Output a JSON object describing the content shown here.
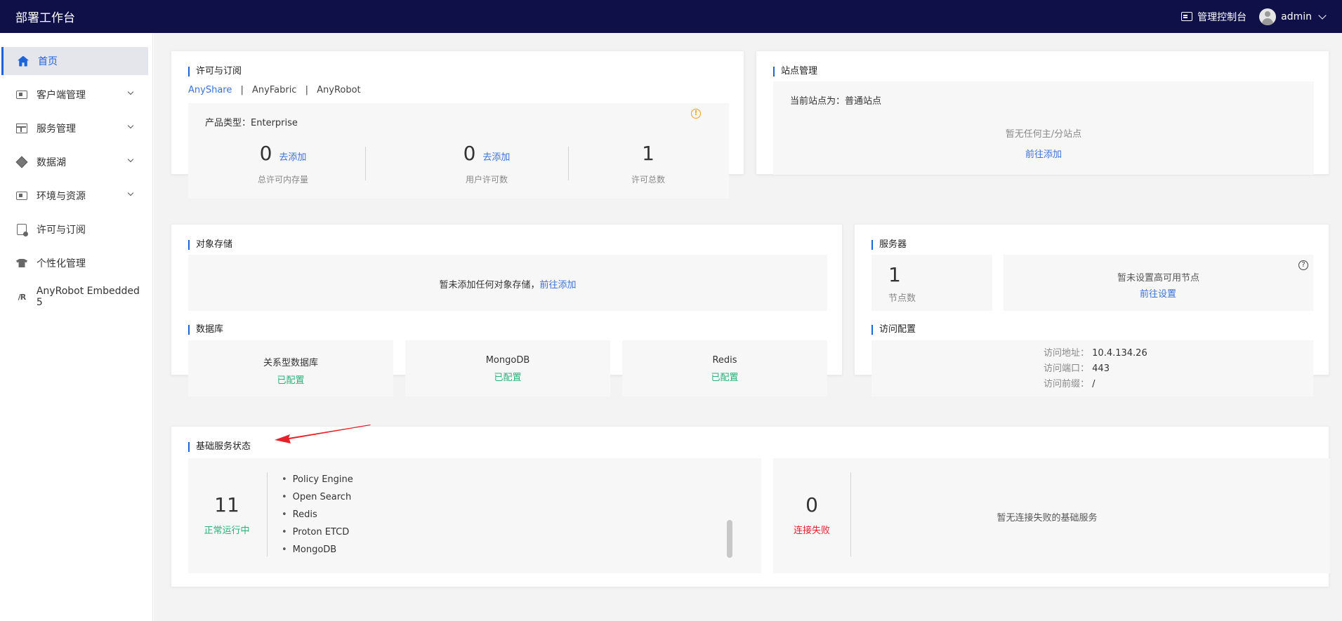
{
  "header": {
    "app_title": "部署工作台",
    "console_label": "管理控制台",
    "user_name": "admin"
  },
  "sidebar": {
    "items": [
      {
        "label": "首页",
        "icon": "home-icon",
        "active": true
      },
      {
        "label": "客户端管理",
        "icon": "client-icon",
        "expandable": true
      },
      {
        "label": "服务管理",
        "icon": "table-icon",
        "expandable": true
      },
      {
        "label": "数据湖",
        "icon": "diamond-icon",
        "expandable": true
      },
      {
        "label": "环境与资源",
        "icon": "code-icon",
        "expandable": true
      },
      {
        "label": "许可与订阅",
        "icon": "license-icon"
      },
      {
        "label": "个性化管理",
        "icon": "shirt-icon"
      },
      {
        "label": "AnyRobot Embedded 5",
        "icon": "anyrobot-icon"
      }
    ]
  },
  "license": {
    "title": "许可与订阅",
    "tabs": [
      "AnyShare",
      "AnyFabric",
      "AnyRobot"
    ],
    "separator": "|",
    "product_type_label": "产品类型：",
    "product_type_value": "Enterprise",
    "stats": [
      {
        "value": "0",
        "action": "去添加",
        "label": "总许可内存量"
      },
      {
        "value": "0",
        "action": "去添加",
        "label": "用户许可数"
      },
      {
        "value": "1",
        "action": "",
        "label": "许可总数"
      }
    ]
  },
  "site": {
    "title": "站点管理",
    "current_label": "当前站点为：",
    "current_value": "普通站点",
    "empty_text": "暂无任何主/分站点",
    "action": "前往添加"
  },
  "object_storage": {
    "title": "对象存储",
    "empty_text": "暂未添加任何对象存储，",
    "action": "前往添加"
  },
  "database": {
    "title": "数据库",
    "items": [
      {
        "name": "关系型数据库",
        "status": "已配置"
      },
      {
        "name": "MongoDB",
        "status": "已配置"
      },
      {
        "name": "Redis",
        "status": "已配置"
      }
    ]
  },
  "server": {
    "title": "服务器",
    "node_count": "1",
    "node_label": "节点数",
    "ha_text": "暂未设置高可用节点",
    "ha_action": "前往设置"
  },
  "access": {
    "title": "访问配置",
    "rows": [
      {
        "label": "访问地址：",
        "value": "10.4.134.26"
      },
      {
        "label": "访问端口：",
        "value": "443"
      },
      {
        "label": "访问前缀：",
        "value": "/"
      }
    ]
  },
  "base_services": {
    "title": "基础服务状态",
    "running_count": "11",
    "running_label": "正常运行中",
    "services": [
      "Policy Engine",
      "Open Search",
      "Redis",
      "Proton ETCD",
      "MongoDB"
    ],
    "failed_count": "0",
    "failed_label": "连接失败",
    "failed_empty": "暂无连接失败的基础服务"
  },
  "colors": {
    "topbar": "#0f1048",
    "accent": "#1d63d9",
    "success": "#2bb07b",
    "danger": "#e5202c",
    "annotation_arrow": "#e8202a"
  }
}
